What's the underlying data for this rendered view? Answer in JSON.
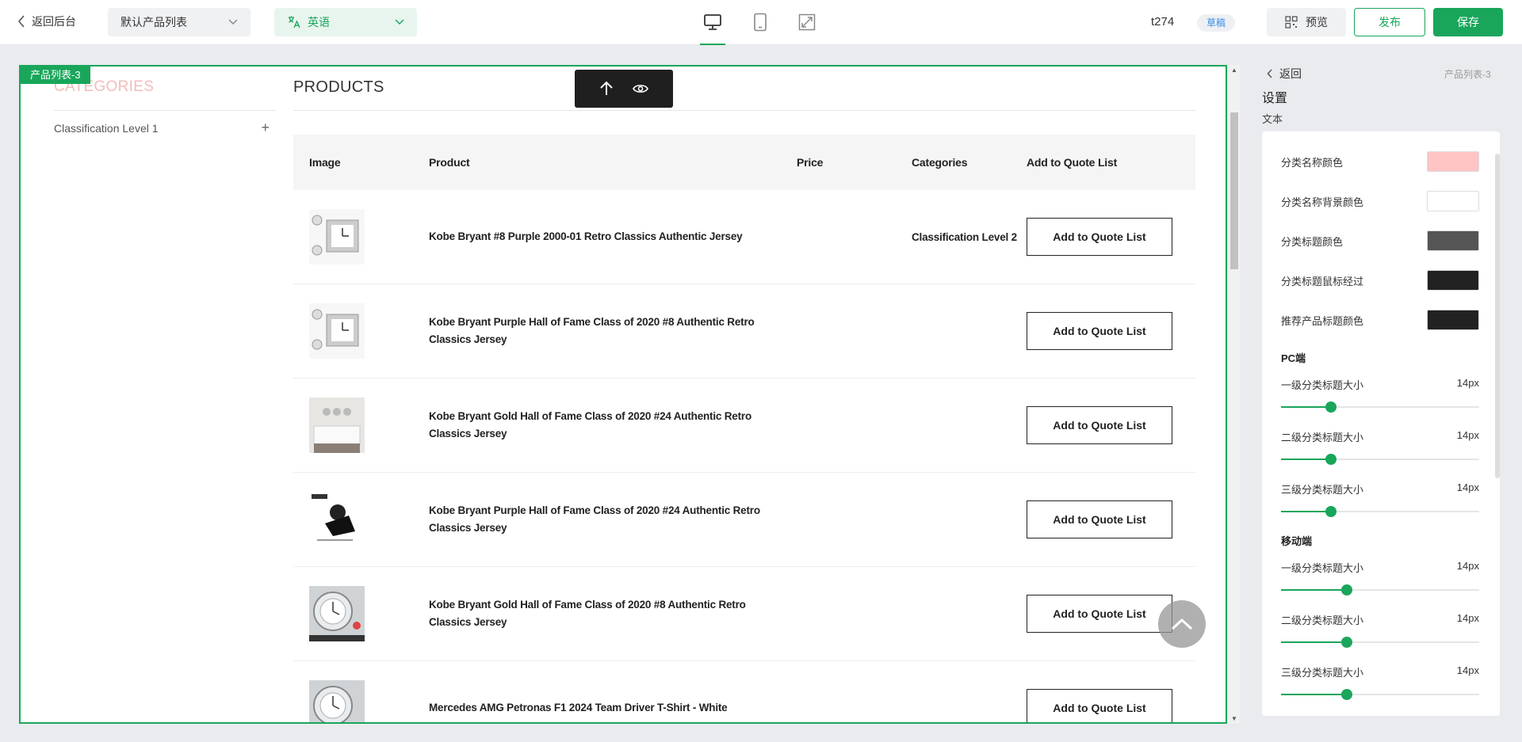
{
  "topbar": {
    "back_label": "返回后台",
    "list_select": "默认产品列表",
    "language_select": "英语",
    "site_name": "t274",
    "status_badge": "草稿",
    "preview_label": "预览",
    "publish_label": "发布",
    "save_label": "保存"
  },
  "canvas": {
    "block_tag": "产品列表-3",
    "categories_heading": "CATEGORIES",
    "category_items": [
      "Classification Level 1"
    ],
    "products_heading": "PRODUCTS",
    "table": {
      "headers": [
        "Image",
        "Product",
        "Price",
        "Categories",
        "Add to Quote List"
      ],
      "rows": [
        {
          "product": "Kobe Bryant #8 Purple 2000-01 Retro Classics Authentic Jersey",
          "price": "",
          "category": "Classification Level 2",
          "button": "Add to Quote List"
        },
        {
          "product": "Kobe Bryant Purple Hall of Fame Class of 2020 #8 Authentic Retro Classics Jersey",
          "price": "",
          "category": "",
          "button": "Add to Quote List"
        },
        {
          "product": "Kobe Bryant Gold Hall of Fame Class of 2020 #24 Authentic Retro Classics Jersey",
          "price": "",
          "category": "",
          "button": "Add to Quote List"
        },
        {
          "product": "Kobe Bryant Purple Hall of Fame Class of 2020 #24 Authentic Retro Classics Jersey",
          "price": "",
          "category": "",
          "button": "Add to Quote List"
        },
        {
          "product": "Kobe Bryant Gold Hall of Fame Class of 2020 #8 Authentic Retro Classics Jersey",
          "price": "",
          "category": "",
          "button": "Add to Quote List"
        },
        {
          "product": "Mercedes AMG Petronas F1 2024 Team Driver T-Shirt - White",
          "price": "",
          "category": "",
          "button": "Add to Quote List"
        }
      ]
    }
  },
  "panel": {
    "back_label": "返回",
    "block_name": "产品列表-3",
    "title": "设置",
    "subtitle": "文本",
    "colors": [
      {
        "label": "分类名称颜色",
        "color": "#ffc4c4"
      },
      {
        "label": "分类名称背景颜色",
        "color": "#ffffff"
      },
      {
        "label": "分类标题颜色",
        "color": "#555555"
      },
      {
        "label": "分类标题鼠标经过",
        "color": "#222222"
      },
      {
        "label": "推荐产品标题颜色",
        "color": "#222222"
      }
    ],
    "pc_section": "PC端",
    "pc_sliders": [
      {
        "label": "一级分类标题大小",
        "value": "14px",
        "fraction": 0.25
      },
      {
        "label": "二级分类标题大小",
        "value": "14px",
        "fraction": 0.25
      },
      {
        "label": "三级分类标题大小",
        "value": "14px",
        "fraction": 0.25
      }
    ],
    "mobile_section": "移动端",
    "mobile_sliders": [
      {
        "label": "一级分类标题大小",
        "value": "14px",
        "fraction": 0.33
      },
      {
        "label": "二级分类标题大小",
        "value": "14px",
        "fraction": 0.33
      },
      {
        "label": "三级分类标题大小",
        "value": "14px",
        "fraction": 0.33
      }
    ]
  },
  "colors": {
    "accent": "#19a65a"
  }
}
